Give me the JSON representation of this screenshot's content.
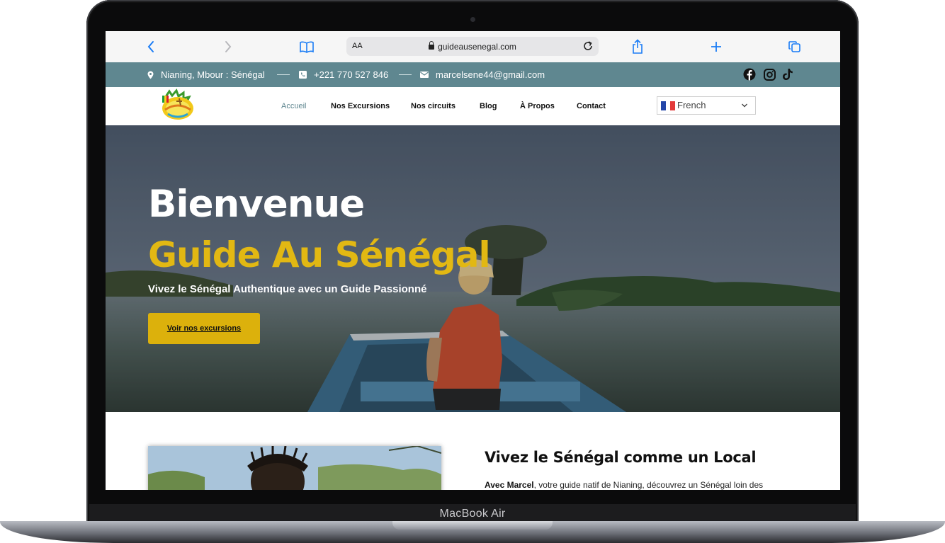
{
  "device": {
    "label": "MacBook Air"
  },
  "browser": {
    "url_text_size_label": "AA",
    "url": "guideausenegal.com",
    "icons": [
      "back-icon",
      "forward-icon",
      "bookmarks-icon",
      "lock-icon",
      "reload-icon",
      "share-icon",
      "new-tab-icon",
      "tabs-icon"
    ]
  },
  "topbar": {
    "location": "Nianing, Mbour : Sénégal",
    "phone": "+221 770 527 846",
    "email": "marcelsene44@gmail.com",
    "background": "#5f8790",
    "social_icons": [
      "facebook-icon",
      "instagram-icon",
      "tiktok-icon"
    ]
  },
  "nav": {
    "items": [
      {
        "label": "Accueil",
        "active": true
      },
      {
        "label": "Nos Excursions"
      },
      {
        "label": "Nos circuits"
      },
      {
        "label": "Blog"
      },
      {
        "label": "À Propos"
      },
      {
        "label": "Contact"
      }
    ],
    "language": {
      "selected": "French"
    }
  },
  "hero": {
    "title_line1": "Bienvenue",
    "title_line2": "Guide Au Sénégal",
    "subtitle": "Vivez le Sénégal Authentique avec un Guide Passionné",
    "cta": "Voir nos excursions",
    "accent_color": "#e2b813",
    "button_color": "#dcb10c"
  },
  "intro": {
    "title": "Vivez le Sénégal comme un Local",
    "body_bold": "Avec Marcel",
    "body_rest": ", votre guide natif de Nianing, découvrez un Sénégal loin des"
  }
}
